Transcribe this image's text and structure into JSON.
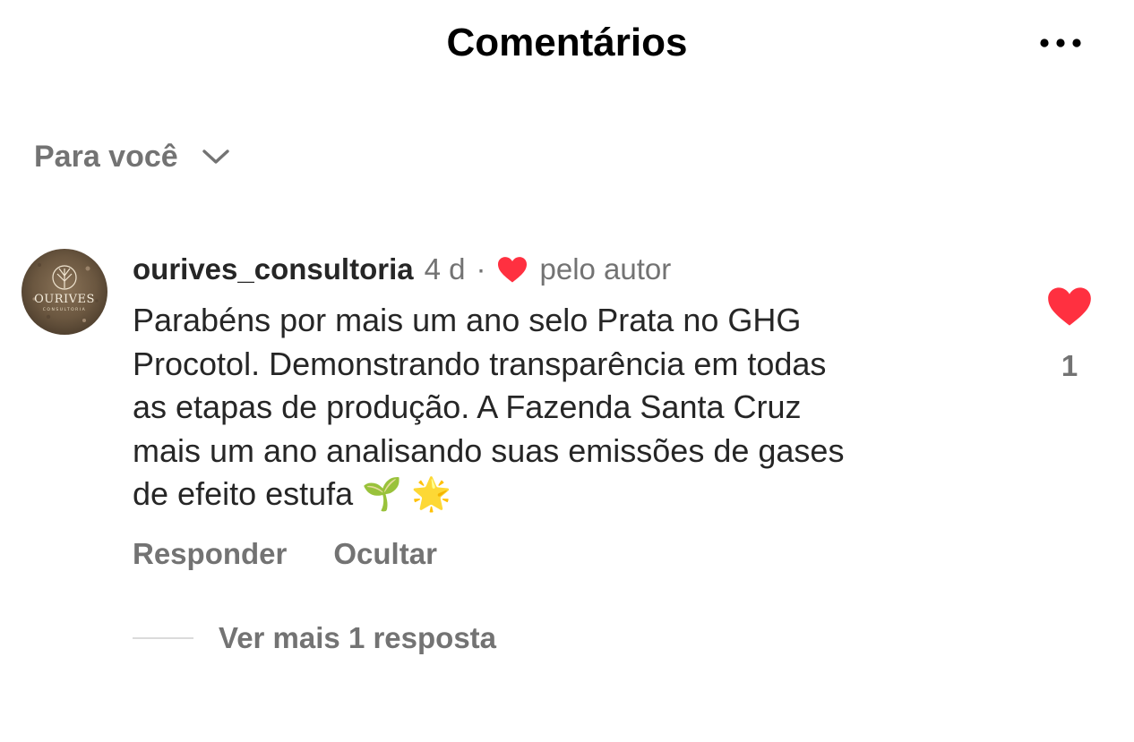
{
  "header": {
    "title": "Comentários",
    "more_icon": "more-horizontal-icon"
  },
  "filter": {
    "label": "Para você",
    "icon": "chevron-down-icon"
  },
  "comment": {
    "avatar": {
      "brand": "OURIVES",
      "sub": "CONSULTORIA"
    },
    "username": "ourives_consultoria",
    "time": "4 d",
    "separator": "·",
    "author_like_icon": "heart-icon",
    "author_like_label": "pelo autor",
    "text": "Parabéns por mais um ano selo Prata no GHG\nProcotol. Demonstrando transparência em todas\nas etapas de produção. A Fazenda Santa Cruz\nmais um ano analisando suas emissões de gases\nde efeito estufa 🌱 🌟",
    "actions": {
      "reply": "Responder",
      "hide": "Ocultar"
    },
    "like": {
      "icon": "heart-icon",
      "count": "1",
      "color": "#ff3040"
    },
    "replies_label": "Ver mais 1 resposta"
  }
}
